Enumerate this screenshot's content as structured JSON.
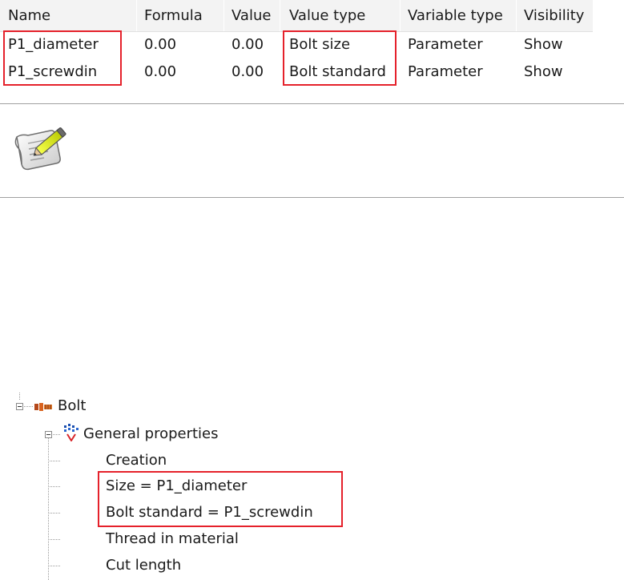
{
  "table": {
    "headers": {
      "name": "Name",
      "formula": "Formula",
      "value": "Value",
      "value_type": "Value type",
      "variable_type": "Variable type",
      "visibility": "Visibility"
    },
    "rows": [
      {
        "name": "P1_diameter",
        "formula": "0.00",
        "value": "0.00",
        "value_type": "Bolt size",
        "variable_type": "Parameter",
        "visibility": "Show"
      },
      {
        "name": "P1_screwdin",
        "formula": "0.00",
        "value": "0.00",
        "value_type": "Bolt standard",
        "variable_type": "Parameter",
        "visibility": "Show"
      }
    ]
  },
  "icon": {
    "name": "notepad-pencil-icon"
  },
  "tree": {
    "root": {
      "label": "Bolt",
      "icon": "bolt-icon"
    },
    "group": {
      "label": "General properties",
      "icon": "properties-icon"
    },
    "items": [
      {
        "label": "Creation"
      },
      {
        "label": "Size = P1_diameter"
      },
      {
        "label": "Bolt standard = P1_screwdin"
      },
      {
        "label": "Thread in material"
      },
      {
        "label": "Cut length"
      }
    ]
  },
  "highlight_color": "#e5212b"
}
